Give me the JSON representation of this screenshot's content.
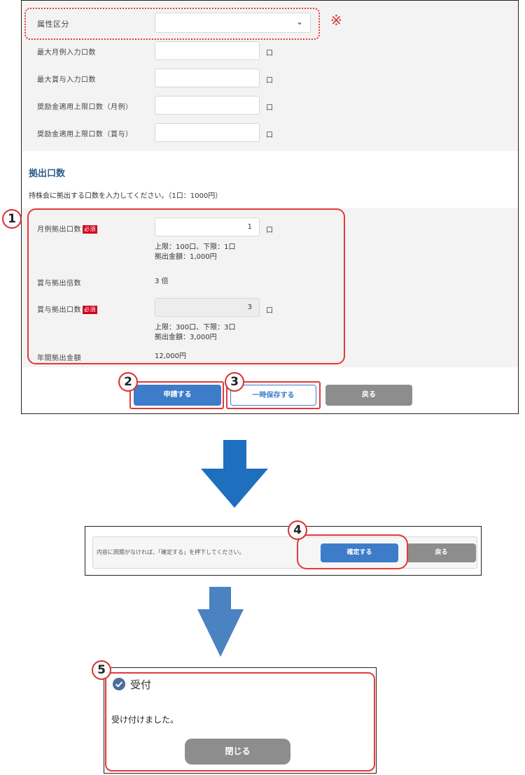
{
  "form": {
    "attribute_label": "属性区分",
    "attribute_value": "",
    "mark": "※",
    "fields": [
      {
        "label": "最大月例入力口数",
        "unit": "口"
      },
      {
        "label": "最大賞与入力口数",
        "unit": "口"
      },
      {
        "label": "奨励金適用上限口数（月例）",
        "unit": "口"
      },
      {
        "label": "奨励金適用上限口数（賞与）",
        "unit": "口"
      }
    ],
    "section_title": "拠出口数",
    "section_desc": "持株会に拠出する口数を入力してください。（1口：1000円）",
    "monthly_label": "月例拠出口数",
    "required_badge": "必須",
    "monthly_value": "1",
    "monthly_unit": "口",
    "monthly_limits": "上限：100口、下限：1口",
    "monthly_amount": "拠出金額：1,000円",
    "bonus_multiplier_label": "賞与拠出倍数",
    "bonus_multiplier_value": "3 倍",
    "bonus_label": "賞与拠出口数",
    "bonus_value": "3",
    "bonus_unit": "口",
    "bonus_limits": "上限：300口、下限：3口",
    "bonus_amount": "拠出金額：3,000円",
    "annual_label": "年間拠出金額",
    "annual_value": "12,000円",
    "buttons": {
      "apply": "申請する",
      "save": "一時保存する",
      "back": "戻る"
    }
  },
  "confirm": {
    "message": "内容に問題がなければ、「確定する」を押下してください。",
    "confirm_button": "確定する",
    "back_button": "戻る"
  },
  "done": {
    "title": "受付",
    "message": "受け付けました。",
    "close_button": "閉じる"
  },
  "markers": [
    "1",
    "2",
    "3",
    "4",
    "5"
  ],
  "colors": {
    "primary": "#3d7cc9",
    "gray_button": "#8d8d8d",
    "highlight": "#e23a3a",
    "arrow1": "#1f6fbf",
    "arrow2": "#4a82c2",
    "heading": "#2f5f8a",
    "check": "#4a6f98"
  }
}
